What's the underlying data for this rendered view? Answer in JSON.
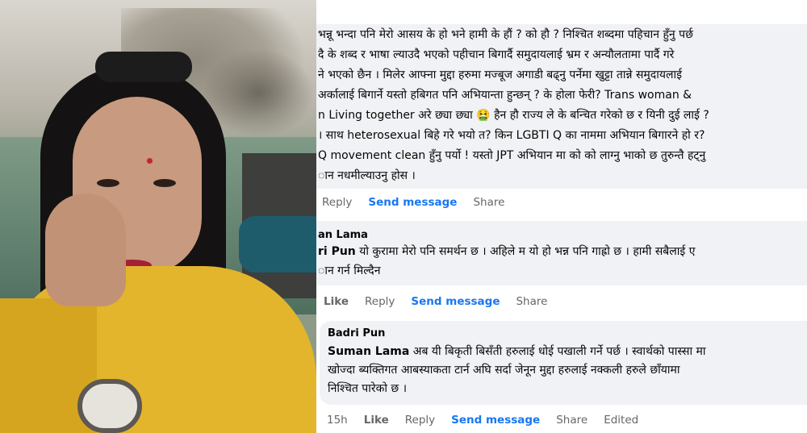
{
  "comment1": {
    "lines": [
      "भन्नू भन्दा पनि मेरो आसय के हो भने हामी के हौं ? को हौ ? निश्चित शब्दमा पहिचान हुँनु पर्छ",
      "दै के शब्द र भाषा ल्याउदै भएको पहीचान बिगार्दै समुदायलाई भ्रम र अन्यौलतामा पार्दै गरे",
      "ने भएको छैन । मिलेर आफ्ना मुद्दा हरुमा मज्बूज अगाडी बढ्नु पर्नेमा खुट्टा तान्ने समुदायलाई",
      "अर्कालाई बिगार्ने यस्तो हबिगत पनि अभियान्ता हुन्छन् ? के होला फेरी? Trans woman &",
      "n Living together अरे छ्या छ्या 🤮 हैन हौ राज्य ले के बन्चित गरेको छ र यिनी दुई लाई ?",
      "। साथ heterosexual बिहे गरे भयो त? किन LGBTI Q का नाममा अभियान बिगारने हो र? ",
      "Q movement clean हुँनु पर्यो ! यस्तो JPT अभियान मा को को लाग्नु भाको छ तुरुन्तै हट्नु",
      "ान नधमील्याउनु होस ।"
    ],
    "actions": [
      "Reply",
      "Send message",
      "Share"
    ]
  },
  "comment2": {
    "author": "an Lama",
    "mention": "ri Pun",
    "lines": [
      "यो कुरामा मेरो पनि समर्थन छ । अहिले म यो हो भन्न पनि गाह्रो छ । हामी सबैलाई ए",
      "ान गर्न मिल्दैन"
    ],
    "actions": [
      "Like",
      "Reply",
      "Send message",
      "Share"
    ]
  },
  "comment3": {
    "author": "Badri Pun",
    "mention": "Suman Lama",
    "lines": [
      "अब यी बिकृती बिसँती हरुलाई धोई पखाली गर्ने पर्छ । स्वार्थको पास्सा मा",
      "खोज्दा ब्यक्तिगत आबस्याकता टार्न अघि सर्दा जेनून मुद्दा हरुलाई नक्कली हरुले छाँयामा",
      "निश्चित पारेको छ ।"
    ],
    "time": "15h",
    "actions": [
      "Like",
      "Reply",
      "Send message",
      "Share",
      "Edited"
    ]
  }
}
